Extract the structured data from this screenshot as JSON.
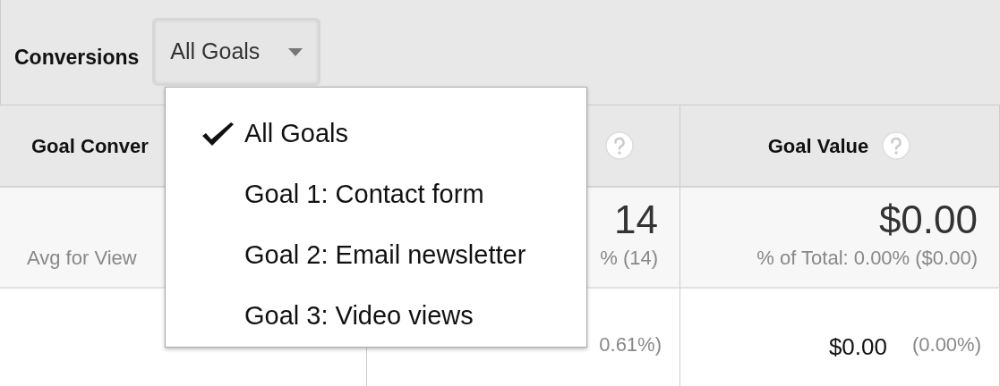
{
  "toolbar": {
    "label": "Conversions",
    "dropdown": {
      "value": "All Goals",
      "expanded": true
    }
  },
  "menu": [
    {
      "label": "All Goals",
      "selected": true
    },
    {
      "label": "Goal 1: Contact form",
      "selected": false
    },
    {
      "label": "Goal 2: Email newsletter",
      "selected": false
    },
    {
      "label": "Goal 3: Video views",
      "selected": false
    }
  ],
  "table": {
    "columns": [
      {
        "label": "Goal Conver",
        "help": false
      },
      {
        "help": true
      },
      {
        "label": "Goal Value",
        "help": true
      }
    ],
    "summary": [
      {
        "note": "Avg for View"
      },
      {
        "value": "14",
        "note": "% (14)"
      },
      {
        "value": "$0.00",
        "note": "% of Total: 0.00% ($0.00)"
      }
    ],
    "rows": [
      {
        "goal_completions": {
          "percent": "0.61%)"
        },
        "goal_value": {
          "value": "$0.00",
          "percent": "(0.00%)"
        }
      }
    ]
  }
}
